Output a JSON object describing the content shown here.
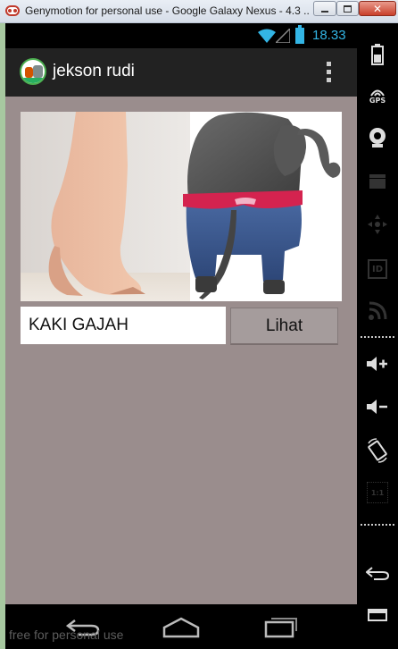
{
  "window": {
    "title": "Genymotion for personal use - Google Galaxy Nexus - 4.3 ...",
    "app_icon": "genymotion-logo",
    "controls": [
      "minimize",
      "maximize",
      "close"
    ]
  },
  "statusbar": {
    "time": "18.33",
    "icons": [
      "wifi-icon",
      "signal-icon",
      "battery-icon"
    ],
    "accent_color": "#33b5e5"
  },
  "actionbar": {
    "title": "jekson rudi",
    "app_icon": "app-avatar-icon",
    "menu_icon": "overflow-menu-icon",
    "background": "#222222"
  },
  "main": {
    "background": "#9a8d8d",
    "image": "elephant-foot-photo",
    "input_value": "KAKI GAJAH",
    "button_label": "Lihat"
  },
  "navbar": {
    "icons": [
      "back-icon",
      "home-icon",
      "recent-apps-icon"
    ]
  },
  "watermark": "free for personal use",
  "sidebar": {
    "gps_label": "GPS",
    "id_label": "ID",
    "pixel_label": "1:1",
    "items": [
      "battery-icon",
      "gps-icon",
      "camera-icon",
      "video-icon",
      "remote-control-icon",
      "id-icon",
      "rss-icon",
      "volume-up-icon",
      "volume-down-icon",
      "rotate-icon",
      "pixel-perfect-icon",
      "back-icon",
      "menu-icon"
    ]
  }
}
